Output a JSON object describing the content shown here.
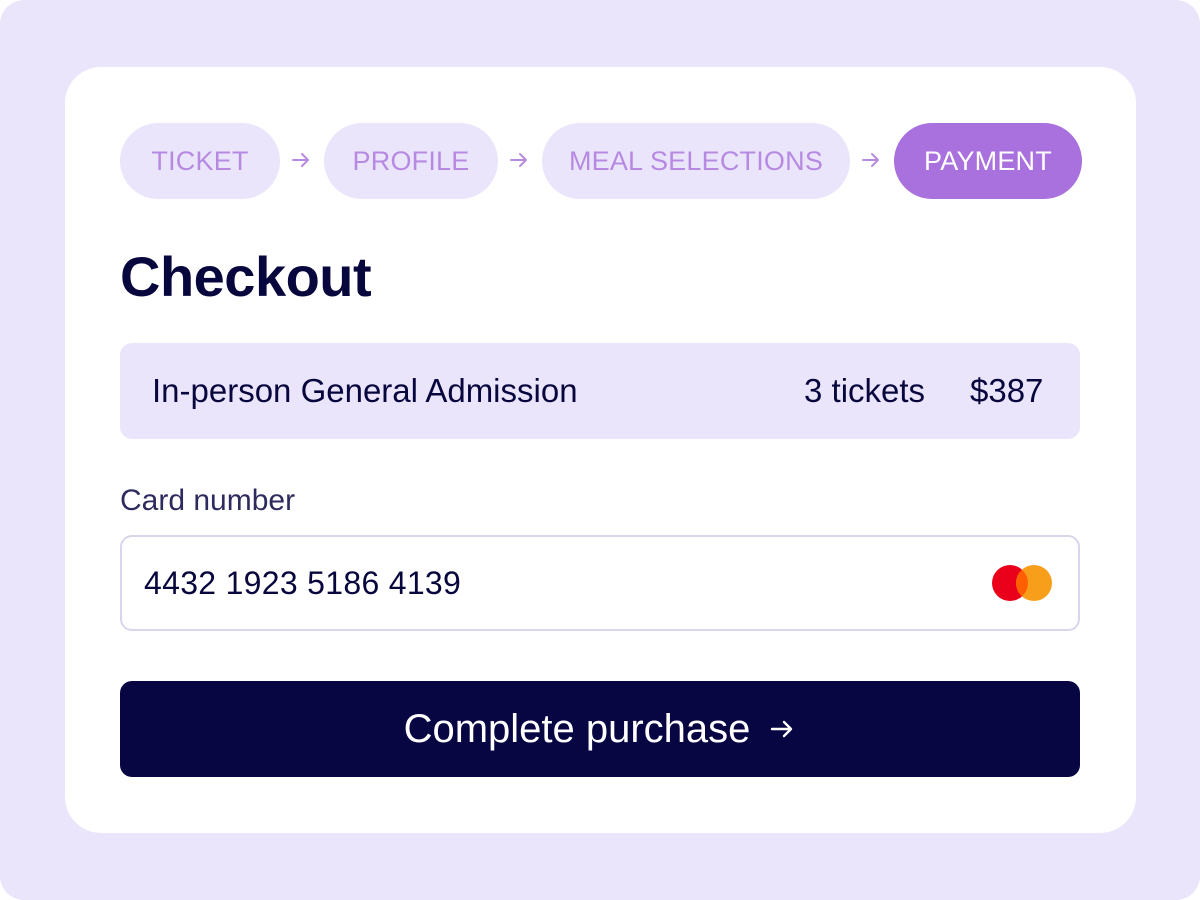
{
  "steps": [
    {
      "label": "TICKET",
      "state": "inactive"
    },
    {
      "label": "PROFILE",
      "state": "inactive"
    },
    {
      "label": "MEAL SELECTIONS",
      "state": "inactive"
    },
    {
      "label": "PAYMENT",
      "state": "active"
    }
  ],
  "page": {
    "title": "Checkout"
  },
  "order": {
    "item": "In-person General Admission",
    "quantity": "3 tickets",
    "price": "$387"
  },
  "payment": {
    "card_label": "Card number",
    "card_value": "4432 1923 5186 4139",
    "card_brand_icon": "mastercard-icon"
  },
  "cta": {
    "label": "Complete purchase"
  },
  "colors": {
    "background": "#ebe5fc",
    "accent": "#a971dd",
    "step_text": "#b78ae2",
    "dark": "#070542",
    "card_red": "#eb001b",
    "card_orange": "#f79e1b"
  }
}
